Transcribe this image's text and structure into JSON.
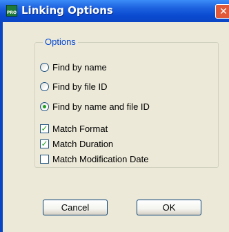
{
  "window": {
    "title": "Linking Options",
    "icon_label": "PRO",
    "close_glyph": "✕"
  },
  "options_group": {
    "legend": "Options",
    "radios": [
      {
        "label": "Find by name",
        "checked": false
      },
      {
        "label": "Find by file ID",
        "checked": false
      },
      {
        "label": "Find by name and file ID",
        "checked": true
      }
    ],
    "checkboxes": [
      {
        "label": "Match Format",
        "checked": true
      },
      {
        "label": "Match Duration",
        "checked": true
      },
      {
        "label": "Match Modification Date",
        "checked": false
      }
    ]
  },
  "buttons": {
    "cancel_label": "Cancel",
    "ok_label": "OK"
  },
  "colors": {
    "titlebar": "#0a46c4",
    "dialog_background": "#ece9d8",
    "legend_text": "#0046d5",
    "check_mark": "#21a121"
  }
}
